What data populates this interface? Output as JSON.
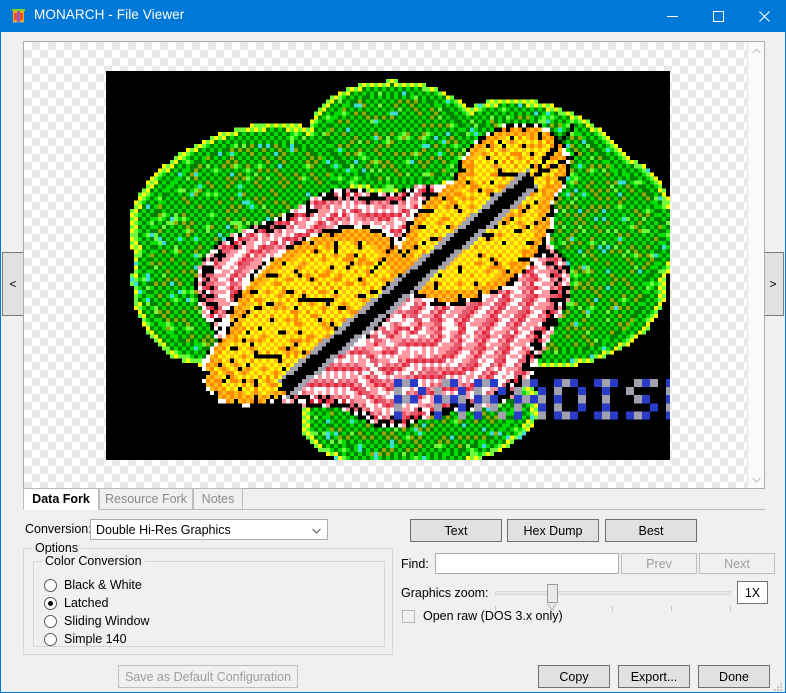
{
  "window": {
    "title": "MONARCH - File Viewer",
    "icon": "monarch-app-icon",
    "accent_color": "#0078d7",
    "controls": {
      "minimize": "minimize-icon",
      "maximize": "maximize-icon",
      "close": "close-icon"
    }
  },
  "preview": {
    "prev_label": "<",
    "next_label": ">",
    "scroll_up": "▲",
    "scroll_down": "▼",
    "artwork_caption": "PARADISE"
  },
  "tabs": [
    {
      "label": "Data Fork",
      "active": true
    },
    {
      "label": "Resource Fork",
      "active": false
    },
    {
      "label": "Notes",
      "active": false
    }
  ],
  "conversion": {
    "label": "Conversion:",
    "value": "Double Hi-Res Graphics",
    "arrow": "chevron-down-icon",
    "options": [
      "Double Hi-Res Graphics"
    ]
  },
  "options": {
    "legend": "Options",
    "color_conversion": {
      "legend": "Color Conversion",
      "items": [
        {
          "label": "Black & White",
          "selected": false
        },
        {
          "label": "Latched",
          "selected": true
        },
        {
          "label": "Sliding Window",
          "selected": false
        },
        {
          "label": "Simple 140",
          "selected": false
        }
      ]
    },
    "save_default_label": "Save as Default Configuration",
    "save_default_disabled": true
  },
  "view_buttons": {
    "text": "Text",
    "hex_dump": "Hex Dump",
    "best": "Best"
  },
  "find": {
    "label": "Find:",
    "value": "",
    "placeholder": "",
    "prev": "Prev",
    "next": "Next",
    "prev_disabled": true,
    "next_disabled": true
  },
  "zoom": {
    "label": "Graphics zoom:",
    "value": "1X",
    "slider_percent": 22
  },
  "open_raw": {
    "label": "Open raw (DOS 3.x only)",
    "checked": false
  },
  "actions": {
    "copy": "Copy",
    "export": "Export...",
    "done": "Done"
  }
}
